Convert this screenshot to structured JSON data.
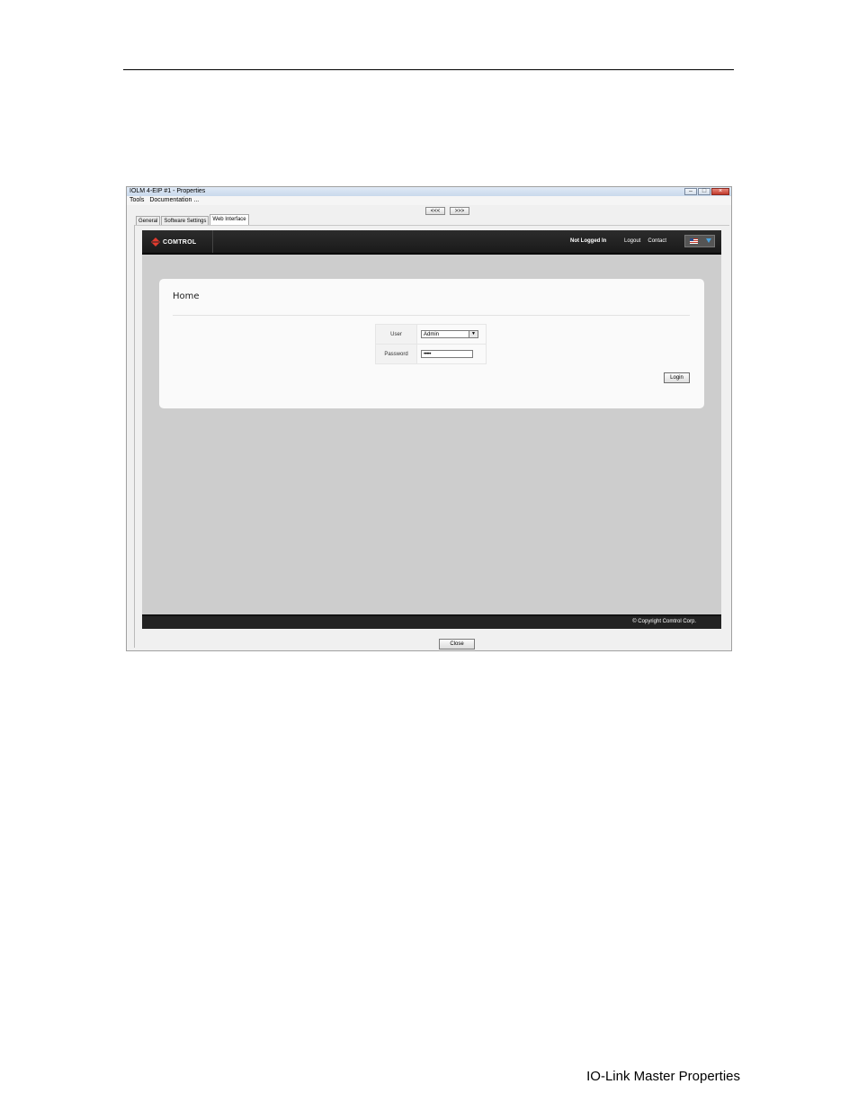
{
  "document": {
    "footer_title": "IO-Link Master Properties"
  },
  "window": {
    "title": "IOLM 4-EIP #1 - Properties",
    "menu": [
      "Tools",
      "Documentation ..."
    ],
    "nav_prev": "<<<",
    "nav_next": ">>>",
    "tabs": [
      "General",
      "Software Settings",
      "Web Interface"
    ],
    "active_tab": "Web Interface",
    "close_button": "Close"
  },
  "web": {
    "brand": "Comtrol",
    "status": "Not Logged In",
    "links": [
      "Logout",
      "Contact"
    ],
    "page_title": "Home",
    "user_label": "User",
    "user_value": "Admin",
    "password_label": "Password",
    "password_value": "•••••",
    "login_button": "Login",
    "copyright": "© Copyright Comtrol Corp."
  }
}
